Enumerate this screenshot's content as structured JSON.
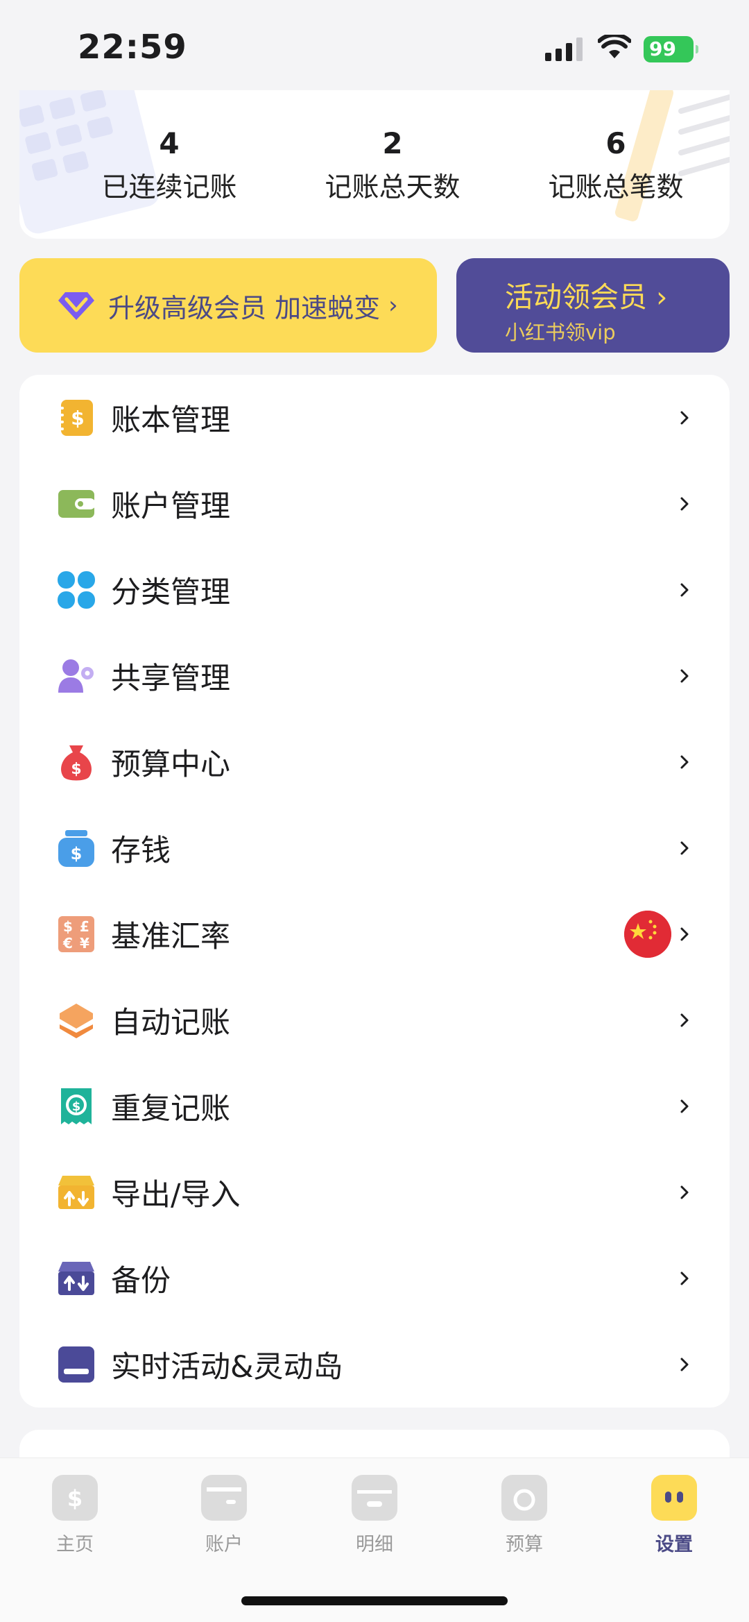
{
  "status_bar": {
    "time": "22:59",
    "battery": "99"
  },
  "stats": [
    {
      "value": "4",
      "label": "已连续记账"
    },
    {
      "value": "2",
      "label": "记账总天数"
    },
    {
      "value": "6",
      "label": "记账总笔数"
    }
  ],
  "promo": {
    "upgrade_label": "升级高级会员 加速蜕变",
    "activity_title": "活动领会员",
    "activity_subtitle": "小红书领vip"
  },
  "menu": [
    {
      "label": "账本管理",
      "icon": "ledger-icon"
    },
    {
      "label": "账户管理",
      "icon": "wallet-icon"
    },
    {
      "label": "分类管理",
      "icon": "category-icon"
    },
    {
      "label": "共享管理",
      "icon": "share-users-icon"
    },
    {
      "label": "预算中心",
      "icon": "money-bag-icon"
    },
    {
      "label": "存钱",
      "icon": "savings-jar-icon"
    },
    {
      "label": "基准汇率",
      "icon": "currency-icon",
      "badge": "china-flag-icon"
    },
    {
      "label": "自动记账",
      "icon": "layers-icon"
    },
    {
      "label": "重复记账",
      "icon": "recurring-receipt-icon"
    },
    {
      "label": "导出/导入",
      "icon": "export-import-icon"
    },
    {
      "label": "备份",
      "icon": "backup-icon"
    },
    {
      "label": "实时活动&灵动岛",
      "icon": "live-activity-icon"
    }
  ],
  "tabs": [
    {
      "label": "主页",
      "icon": "home-dollar-icon"
    },
    {
      "label": "账户",
      "icon": "card-icon"
    },
    {
      "label": "明细",
      "icon": "calendar-icon"
    },
    {
      "label": "预算",
      "icon": "budget-icon"
    },
    {
      "label": "设置",
      "icon": "settings-face-icon",
      "active": true
    }
  ],
  "colors": {
    "accent_yellow": "#fddb57",
    "accent_purple": "#514c98",
    "text_purple": "#4b4a86"
  }
}
